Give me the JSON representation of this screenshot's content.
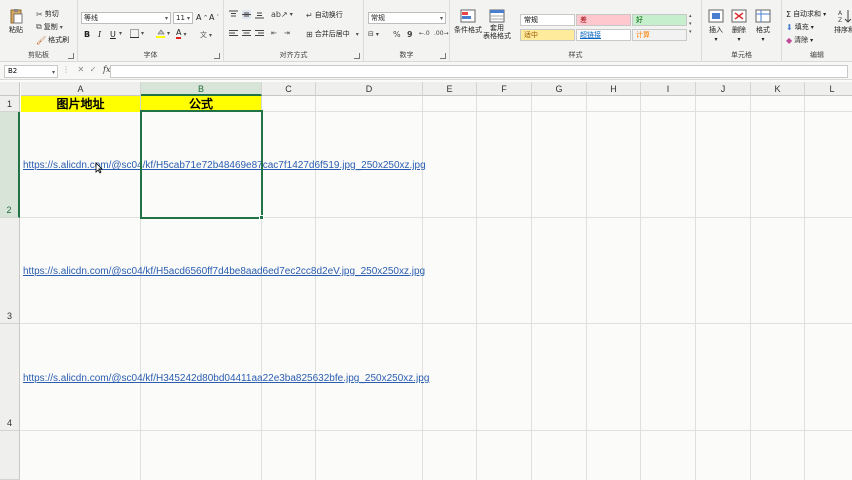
{
  "ribbon": {
    "clipboard": {
      "paste": "粘贴",
      "cut": "剪切",
      "copy": "复制",
      "format_painter": "格式刷",
      "label": "剪贴板"
    },
    "font": {
      "name": "等线",
      "size": "11",
      "label": "字体",
      "bold": "B",
      "italic": "I",
      "underline": "U"
    },
    "alignment": {
      "wrap": "自动换行",
      "merge": "合并后居中",
      "label": "对齐方式"
    },
    "number": {
      "format": "常规",
      "label": "数字"
    },
    "styles": {
      "conditional": "条件格式",
      "table_format": "套用\n表格格式",
      "label": "样式",
      "cells": [
        {
          "text": "常规",
          "bg": "#ffffff",
          "fg": "#000000"
        },
        {
          "text": "差",
          "bg": "#ffc7ce",
          "fg": "#9c0006"
        },
        {
          "text": "好",
          "bg": "#c6efce",
          "fg": "#006100"
        },
        {
          "text": "适中",
          "bg": "#ffeb9c",
          "fg": "#9c5700"
        },
        {
          "text": "超链接",
          "bg": "#ffffff",
          "fg": "#0563c1"
        },
        {
          "text": "计算",
          "bg": "#f2f2f2",
          "fg": "#fa7d00"
        }
      ]
    },
    "cells_group": {
      "insert": "插入",
      "delete": "删除",
      "format": "格式",
      "label": "单元格"
    },
    "editing": {
      "autosum": "自动求和",
      "fill": "填充",
      "clear": "清除",
      "sort": "排序和",
      "label": "编辑"
    }
  },
  "formula_bar": {
    "name_box": "B2",
    "fx": "fx",
    "value": ""
  },
  "sheet": {
    "columns": [
      "A",
      "B",
      "C",
      "D",
      "E",
      "F",
      "G",
      "H",
      "I",
      "J",
      "K",
      "L"
    ],
    "rows": [
      "1",
      "2",
      "3",
      "4"
    ],
    "header_a": "图片地址",
    "header_b": "公式",
    "links": [
      "https://s.alicdn.com/@sc04/kf/H5cab71e72b48469e87cac7f1427d6f519.jpg_250x250xz.jpg",
      "https://s.alicdn.com/@sc04/kf/H5acd6560ff7d4be8aad6ed7ec2cc8d2eV.jpg_250x250xz.jpg",
      "https://s.alicdn.com/@sc04/kf/H345242d80bd04411aa22e3ba825632bfe.jpg_250x250xz.jpg"
    ],
    "selected_cell": "B2",
    "accent": "#217346"
  }
}
